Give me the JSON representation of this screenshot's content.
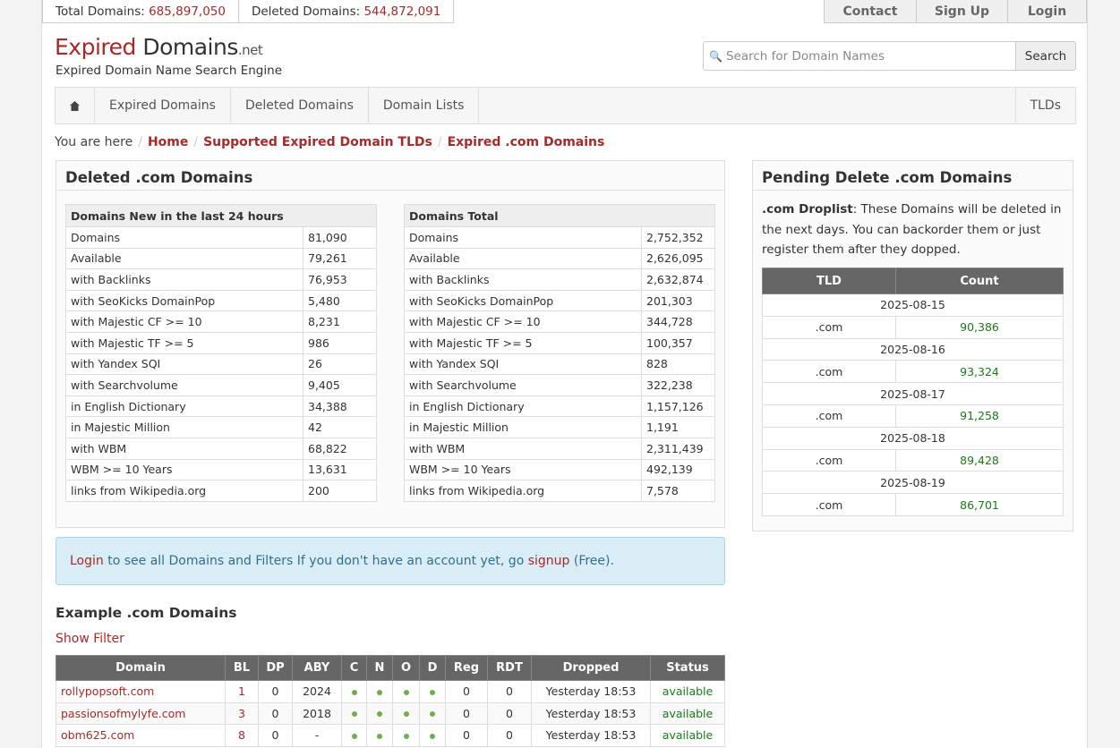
{
  "topbar": {
    "total_label": "Total Domains:",
    "total_value": "685,897,050",
    "deleted_label": "Deleted Domains:",
    "deleted_value": "544,872,091"
  },
  "topnav": [
    "Contact",
    "Sign Up",
    "Login"
  ],
  "logo": {
    "part1": "Expired",
    "part2": " Domains",
    "part3": ".net",
    "tagline": "Expired Domain Name Search Engine"
  },
  "search": {
    "placeholder": "Search for Domain Names",
    "button": "Search"
  },
  "mainnav": {
    "items": [
      "Expired Domains",
      "Deleted Domains",
      "Domain Lists"
    ],
    "tlds": "TLDs"
  },
  "breadcrumb": {
    "prefix": "You are here",
    "items": [
      "Home",
      "Supported Expired Domain TLDs",
      "Expired .com Domains"
    ]
  },
  "deleted_panel": {
    "title": "Deleted .com Domains",
    "new_table": {
      "header": "Domains New in the last 24 hours",
      "rows": [
        [
          "Domains",
          "81,090"
        ],
        [
          "Available",
          "79,261"
        ],
        [
          "with Backlinks",
          "76,953"
        ],
        [
          "with SeoKicks DomainPop",
          "5,480"
        ],
        [
          "with Majestic CF >= 10",
          "8,231"
        ],
        [
          "with Majestic TF >= 5",
          "986"
        ],
        [
          "with Yandex SQI",
          "26"
        ],
        [
          "with Searchvolume",
          "9,405"
        ],
        [
          "in English Dictionary",
          "34,388"
        ],
        [
          "in Majestic Million",
          "42"
        ],
        [
          "with WBM",
          "68,822"
        ],
        [
          "WBM >= 10 Years",
          "13,631"
        ],
        [
          "links from Wikipedia.org",
          "200"
        ]
      ]
    },
    "total_table": {
      "header": "Domains Total",
      "rows": [
        [
          "Domains",
          "2,752,352"
        ],
        [
          "Available",
          "2,626,095"
        ],
        [
          "with Backlinks",
          "2,632,874"
        ],
        [
          "with SeoKicks DomainPop",
          "201,303"
        ],
        [
          "with Majestic CF >= 10",
          "344,728"
        ],
        [
          "with Majestic TF >= 5",
          "100,357"
        ],
        [
          "with Yandex SQI",
          "828"
        ],
        [
          "with Searchvolume",
          "322,238"
        ],
        [
          "in English Dictionary",
          "1,157,126"
        ],
        [
          "in Majestic Million",
          "1,191"
        ],
        [
          "with WBM",
          "2,311,439"
        ],
        [
          "WBM >= 10 Years",
          "492,139"
        ],
        [
          "links from Wikipedia.org",
          "7,578"
        ]
      ]
    }
  },
  "pending_panel": {
    "title": "Pending Delete .com Domains",
    "desc_bold": ".com Droplist",
    "desc_text": ": These Domains will be deleted in the next days. You can backorder them or just register them after they dopped.",
    "col_tld": "TLD",
    "col_count": "Count",
    "days": [
      {
        "date": "2025-08-15",
        "tld": ".com",
        "count": "90,386"
      },
      {
        "date": "2025-08-16",
        "tld": ".com",
        "count": "93,324"
      },
      {
        "date": "2025-08-17",
        "tld": ".com",
        "count": "91,258"
      },
      {
        "date": "2025-08-18",
        "tld": ".com",
        "count": "89,428"
      },
      {
        "date": "2025-08-19",
        "tld": ".com",
        "count": "86,701"
      }
    ]
  },
  "info": {
    "login": "Login",
    "text1": " to see all Domains and Filters If you don't have an account yet, go ",
    "signup": "signup",
    "text2": " (Free)."
  },
  "examples": {
    "title": "Example .com Domains",
    "show_filter": "Show Filter",
    "columns": [
      "Domain",
      "BL",
      "DP",
      "ABY",
      "C",
      "N",
      "O",
      "D",
      "Reg",
      "RDT",
      "Dropped",
      "Status"
    ],
    "rows": [
      {
        "domain": "rollypopsoft.com",
        "bl": "1",
        "dp": "0",
        "aby": "2024",
        "reg": "0",
        "rdt": "0",
        "dropped": "Yesterday 18:53",
        "status": "available"
      },
      {
        "domain": "passionsofmylyfe.com",
        "bl": "3",
        "dp": "0",
        "aby": "2018",
        "reg": "0",
        "rdt": "0",
        "dropped": "Yesterday 18:53",
        "status": "available"
      },
      {
        "domain": "obm625.com",
        "bl": "8",
        "dp": "0",
        "aby": "-",
        "reg": "0",
        "rdt": "0",
        "dropped": "Yesterday 18:53",
        "status": "available"
      }
    ]
  }
}
